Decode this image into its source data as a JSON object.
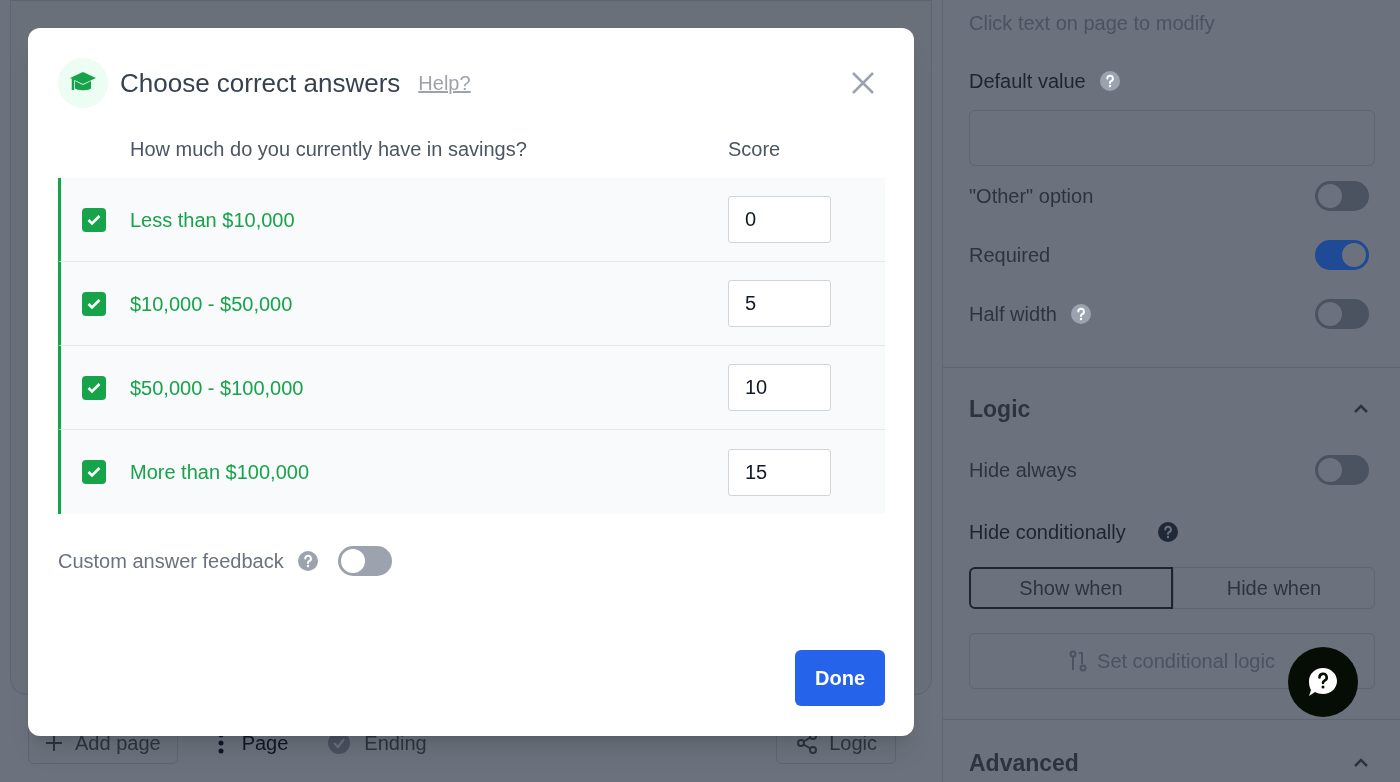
{
  "canvas": {
    "bottom_bar": {
      "add_page": "Add page",
      "page": "Page",
      "ending": "Ending",
      "logic": "Logic"
    }
  },
  "panel": {
    "hint": "Click text on page to modify",
    "default_value": {
      "label": "Default value"
    },
    "toggles": [
      {
        "label": "\"Other\" option",
        "on": false,
        "help": false
      },
      {
        "label": "Required",
        "on": true,
        "help": false
      },
      {
        "label": "Half width",
        "on": false,
        "help": true
      }
    ],
    "logic": {
      "title": "Logic",
      "expanded": true,
      "hide_always": {
        "label": "Hide always",
        "on": false
      },
      "hide_conditionally": "Hide conditionally",
      "modes": [
        {
          "label": "Show when",
          "selected": true
        },
        {
          "label": "Hide when",
          "selected": false
        }
      ],
      "set_logic": "Set conditional logic"
    },
    "advanced": {
      "title": "Advanced",
      "expanded": true
    }
  },
  "modal": {
    "title": "Choose correct answers",
    "help_link": "Help?",
    "question": "How much do you currently have in savings?",
    "score_heading": "Score",
    "options": [
      {
        "label": "Less than $10,000",
        "checked": true,
        "score": "0"
      },
      {
        "label": "$10,000 - $50,000",
        "checked": true,
        "score": "5"
      },
      {
        "label": "$50,000 - $100,000",
        "checked": true,
        "score": "10"
      },
      {
        "label": "More than $100,000",
        "checked": true,
        "score": "15"
      }
    ],
    "feedback": {
      "label": "Custom answer feedback",
      "on": false
    },
    "done": "Done"
  }
}
